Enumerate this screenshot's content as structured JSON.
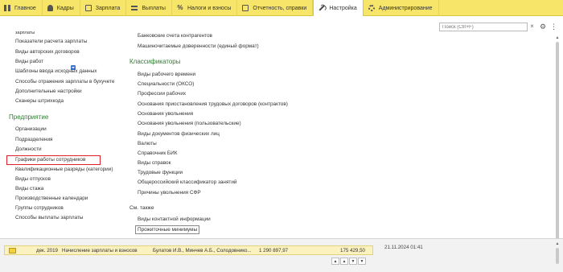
{
  "nav": {
    "tabs": [
      {
        "label": "Главное",
        "icon": "grid-icon"
      },
      {
        "label": "Кадры",
        "icon": "people-icon"
      },
      {
        "label": "Зарплата",
        "icon": "document-icon"
      },
      {
        "label": "Выплаты",
        "icon": "list-icon"
      },
      {
        "label": "Налоги и взносы",
        "icon": "percent-icon"
      },
      {
        "label": "Отчетность, справки",
        "icon": "report-icon"
      },
      {
        "label": "Настройка",
        "icon": "wrench-icon",
        "active": true
      },
      {
        "label": "Администрирование",
        "icon": "gear-icon"
      }
    ],
    "accent_color": "#f7e56a"
  },
  "search": {
    "placeholder": "Поиск (Ctrl+F)",
    "clear": "×"
  },
  "toolbar": {
    "settings_glyph": "⚙",
    "more_glyph": "⋮"
  },
  "left": {
    "cut_item": "зарплаты",
    "items": [
      "Показатели расчета зарплаты",
      "Виды авторских договоров",
      "Виды работ",
      "Шаблоны ввода исходных данных",
      "Способы отражения зарплаты в бухучете",
      "Дополнительные настройки",
      "Сканеры штрихкода"
    ],
    "enterprise_heading": "Предприятие",
    "enterprise_items": [
      "Организации",
      "Подразделения",
      "Должности",
      "Графики работы сотрудников",
      "Квалификационные разряды (категории)",
      "Виды отпусков",
      "Виды стажа",
      "Производственные календари",
      "Группы сотрудников",
      "Способы выплаты зарплаты"
    ]
  },
  "right": {
    "top_items": [
      "Банковские счета контрагентов",
      "Машиночитаемые доверенности (единый формат)"
    ],
    "classifiers_heading": "Классификаторы",
    "classifiers": [
      "Виды рабочего времени",
      "Специальности (ОКСО)",
      "Профессии рабочих",
      "Основания приостановления трудовых договоров (контрактов)",
      "Основания увольнения",
      "Основания увольнения (пользовательские)",
      "Виды документов физических лиц",
      "Валюты",
      "Справочник БИК",
      "Виды справок",
      "Трудовые функции",
      "Общероссийский классификатор занятий",
      "Причины увольнения СФР"
    ],
    "see_also_heading": "См. также",
    "see_also": [
      "Виды контактной информации",
      "Прожиточные минимумы"
    ]
  },
  "bottom": {
    "row": {
      "period": "дек. 2019",
      "document": "Начисление зарплаты и взносов",
      "employees": "Булатов И.В., Минчев А.Б., Солодовнико...",
      "amount1": "1 290 897,97",
      "amount2": "175 429,50"
    },
    "date": "21.11.2024 01:41",
    "nav_glyphs": [
      "▲",
      "▲",
      "▼",
      "▼"
    ]
  }
}
